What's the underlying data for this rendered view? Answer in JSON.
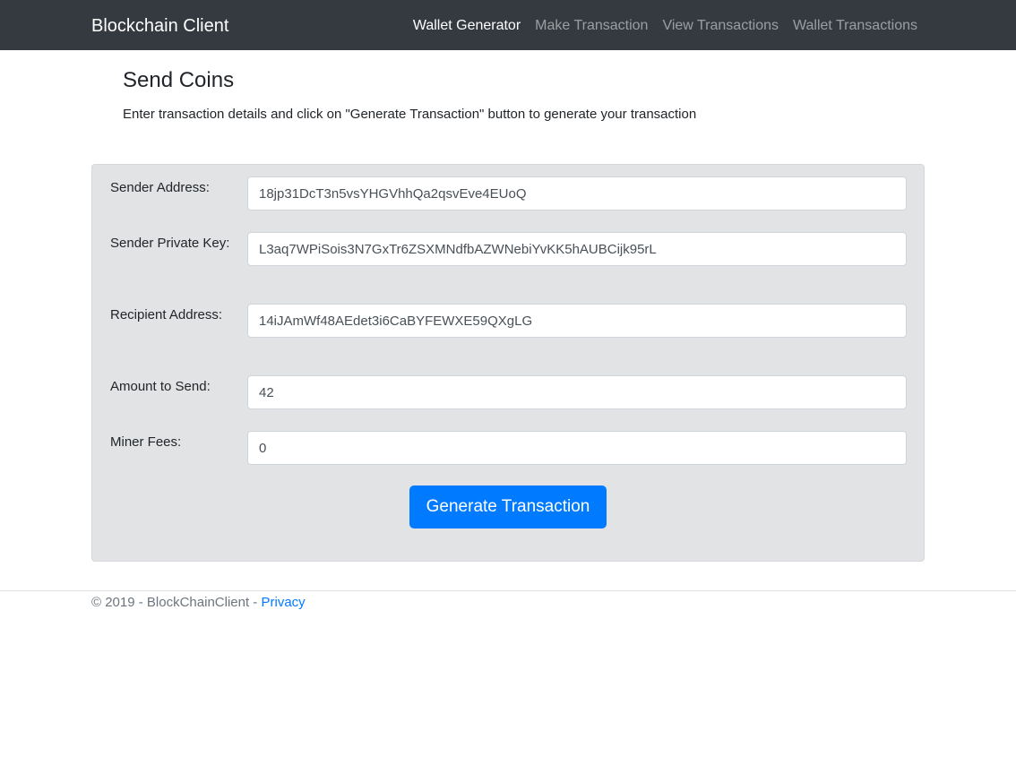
{
  "navbar": {
    "brand": "Blockchain Client",
    "links": [
      {
        "label": "Wallet Generator",
        "active": true
      },
      {
        "label": "Make Transaction",
        "active": false
      },
      {
        "label": "View Transactions",
        "active": false
      },
      {
        "label": "Wallet Transactions",
        "active": false
      }
    ]
  },
  "main": {
    "title": "Send Coins",
    "description": "Enter transaction details and click on \"Generate Transaction\" button to generate your transaction"
  },
  "form": {
    "sender_address": {
      "label": "Sender Address:",
      "value": "18jp31DcT3n5vsYHGVhhQa2qsvEve4EUoQ"
    },
    "sender_private_key": {
      "label": "Sender Private Key:",
      "value": "L3aq7WPiSois3N7GxTr6ZSXMNdfbAZWNebiYvKK5hAUBCijk95rL"
    },
    "recipient_address": {
      "label": "Recipient Address:",
      "value": "14iJAmWf48AEdet3i6CaBYFEWXE59QXgLG"
    },
    "amount": {
      "label": "Amount to Send:",
      "value": "42"
    },
    "miner_fees": {
      "label": "Miner Fees:",
      "value": "0"
    },
    "submit_label": "Generate Transaction"
  },
  "footer": {
    "text": "© 2019 - BlockChainClient - ",
    "privacy_link": "Privacy"
  },
  "colors": {
    "navbar_bg": "#343a40",
    "card_bg": "#e2e3e5",
    "primary": "#007bff"
  }
}
